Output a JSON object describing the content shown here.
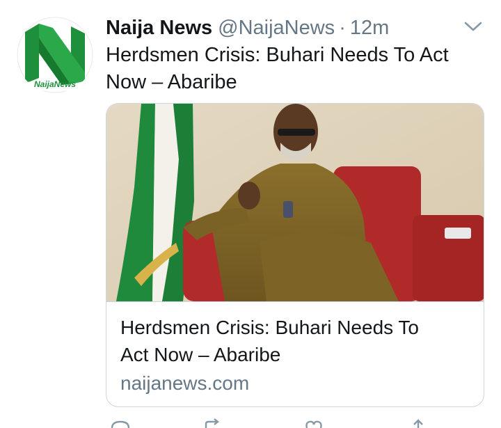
{
  "tweet": {
    "author": {
      "display_name": "Naija News",
      "handle": "@NaijaNews",
      "separator": "·",
      "timestamp": "12m",
      "avatar_logo_text": "NaijaNews"
    },
    "text_line1": "Herdsmen Crisis: Buhari Needs To Act",
    "text_line2": "Now – Abaribe",
    "card": {
      "title_line1": "Herdsmen Crisis: Buhari Needs To",
      "title_line2": "Act Now – Abaribe",
      "domain": "naijanews.com"
    },
    "icons": {
      "caret": "chevron-down-icon",
      "reply": "reply-icon",
      "retweet": "retweet-icon",
      "like": "like-icon",
      "share": "share-icon"
    },
    "colors": {
      "brand_green": "#1e8f3a",
      "text_primary": "#14171a",
      "text_secondary": "#657786",
      "border": "#ccd6dd"
    }
  }
}
